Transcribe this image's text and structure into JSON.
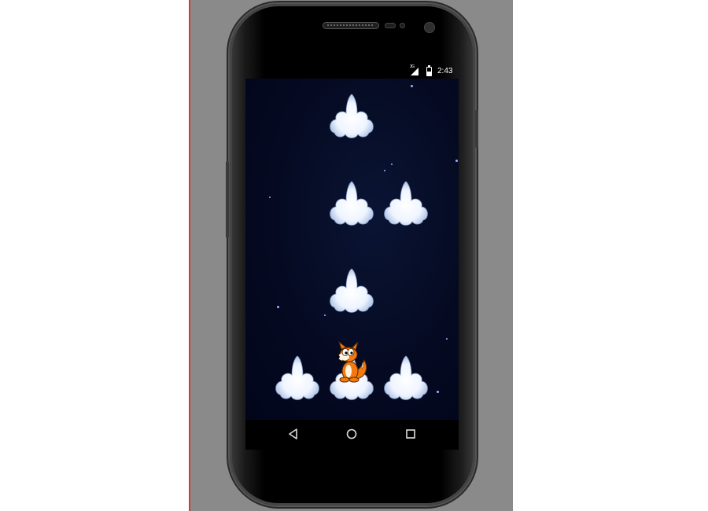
{
  "emulator": {
    "status_bar": {
      "network_label": "3G",
      "time": "2:43",
      "signal_icon": "cell-signal-icon",
      "battery_icon": "battery-charging-icon"
    },
    "game": {
      "background": "starry-night",
      "clouds": [
        {
          "row": 1,
          "column": 2
        },
        {
          "row": 2,
          "column": 2
        },
        {
          "row": 2,
          "column": 3
        },
        {
          "row": 3,
          "column": 2
        },
        {
          "row": 4,
          "column": 1
        },
        {
          "row": 4,
          "column": 2
        },
        {
          "row": 4,
          "column": 3
        }
      ],
      "player": {
        "character": "fox",
        "row": 4,
        "column": 2
      }
    },
    "nav_bar": {
      "back_icon": "back-triangle-icon",
      "home_icon": "home-circle-icon",
      "recents_icon": "recents-square-icon"
    },
    "colors": {
      "screen_background": "#050a22",
      "panel_background": "#8a8a8a",
      "phone_body": "#000000",
      "cloud": "#e8f1ff",
      "fox": "#f07a10"
    }
  }
}
